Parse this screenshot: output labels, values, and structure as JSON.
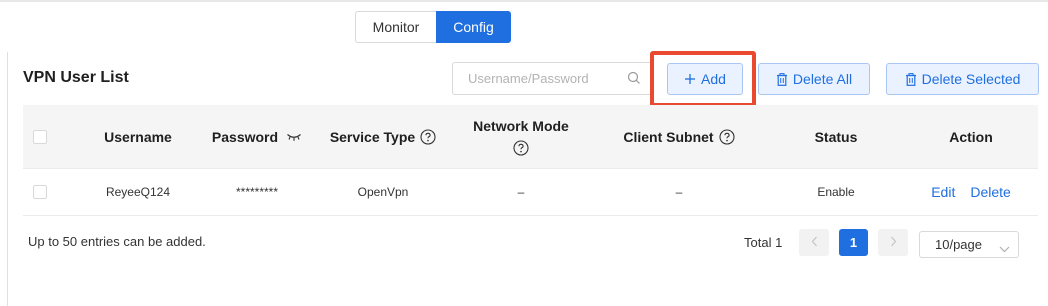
{
  "tabs": [
    {
      "label": "Monitor",
      "active": false
    },
    {
      "label": "Config",
      "active": true
    }
  ],
  "page_title": "VPN User List",
  "search": {
    "placeholder": "Username/Password",
    "value": ""
  },
  "toolbar": {
    "add_label": "Add",
    "delete_all_label": "Delete All",
    "delete_selected_label": "Delete Selected"
  },
  "table": {
    "headers": {
      "username": "Username",
      "password": "Password",
      "service_type": "Service Type",
      "network_mode": "Network Mode",
      "client_subnet": "Client Subnet",
      "status": "Status",
      "action": "Action"
    },
    "rows": [
      {
        "username": "ReyeeQ124",
        "password": "*********",
        "service_type": "OpenVpn",
        "network_mode": "–",
        "client_subnet": "–",
        "status": "Enable",
        "edit_label": "Edit",
        "delete_label": "Delete"
      }
    ]
  },
  "footer": {
    "note": "Up to 50 entries can be added.",
    "total": "Total 1",
    "current_page": "1",
    "page_size": "10/page"
  },
  "colors": {
    "accent": "#1f6fe0",
    "highlight_box": "#e8492f",
    "header_bg": "#f5f5f5"
  }
}
